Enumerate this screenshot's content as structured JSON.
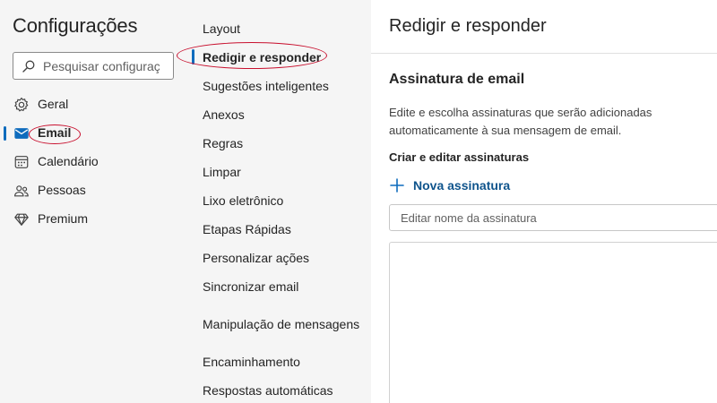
{
  "sidebar": {
    "title": "Configurações",
    "search_placeholder": "Pesquisar configurações",
    "categories": [
      {
        "label": "Geral",
        "icon": "gear-icon"
      },
      {
        "label": "Email",
        "icon": "mail-icon",
        "selected": true
      },
      {
        "label": "Calendário",
        "icon": "calendar-icon"
      },
      {
        "label": "Pessoas",
        "icon": "people-icon"
      },
      {
        "label": "Premium",
        "icon": "diamond-icon"
      }
    ]
  },
  "submenu": {
    "items": [
      {
        "label": "Layout"
      },
      {
        "label": "Redigir e responder",
        "selected": true
      },
      {
        "label": "Sugestões inteligentes"
      },
      {
        "label": "Anexos"
      },
      {
        "label": "Regras"
      },
      {
        "label": "Limpar"
      },
      {
        "label": "Lixo eletrônico"
      },
      {
        "label": "Etapas Rápidas"
      },
      {
        "label": "Personalizar ações"
      },
      {
        "label": "Sincronizar email"
      },
      {
        "label": "Manipulação de mensagens"
      },
      {
        "label": "Encaminhamento"
      },
      {
        "label": "Respostas automáticas"
      }
    ]
  },
  "main": {
    "title": "Redigir e responder",
    "signature_section": {
      "title": "Assinatura de email",
      "description": "Edite e escolha assinaturas que serão adicionadas automaticamente à sua mensagem de email.",
      "create_heading": "Criar e editar assinaturas",
      "new_signature_label": "Nova assinatura",
      "name_placeholder": "Editar nome da assinatura"
    }
  },
  "colors": {
    "accent": "#0f6cbd",
    "link": "#0f548c",
    "annotation": "#c8102e",
    "nav_background": "#f5f5f5"
  }
}
